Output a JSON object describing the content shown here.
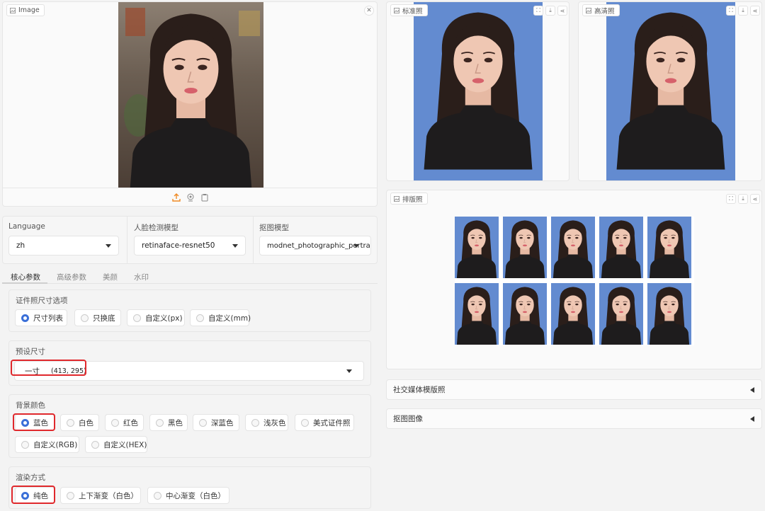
{
  "input_panel": {
    "label": "Image",
    "close_icon": "close-icon",
    "toolbar_icons": [
      "upload-icon",
      "webcam-icon",
      "clipboard-icon"
    ],
    "accent": "#f08a24"
  },
  "output_std": {
    "label": "标准照"
  },
  "output_hd": {
    "label": "高清照"
  },
  "output_layout": {
    "label": "排版照",
    "rows": 2,
    "cols": 5
  },
  "selects": {
    "language": {
      "label": "Language",
      "value": "zh"
    },
    "face_model": {
      "label": "人脸检测模型",
      "value": "retinaface-resnet50"
    },
    "matting_model": {
      "label": "抠图模型",
      "value": "modnet_photographic_portrait"
    }
  },
  "tabs": [
    "核心参数",
    "高级参数",
    "美颜",
    "水印"
  ],
  "size_option": {
    "label": "证件照尺寸选项",
    "options": [
      "尺寸列表",
      "只换底",
      "自定义(px)",
      "自定义(mm)"
    ],
    "selected": 0
  },
  "preset_size": {
    "label": "预设尺寸",
    "value_name": "一寸",
    "value_dims": "(413, 295)"
  },
  "bg_color": {
    "label": "背景颜色",
    "options": [
      "蓝色",
      "白色",
      "红色",
      "黑色",
      "深蓝色",
      "浅灰色",
      "美式证件照",
      "自定义(RGB)",
      "自定义(HEX)"
    ],
    "selected": 0,
    "blue": "#638bd0"
  },
  "render_mode": {
    "label": "渲染方式",
    "options": [
      "纯色",
      "上下渐变（白色）",
      "中心渐变（白色）"
    ],
    "selected": 0
  },
  "accordions": {
    "social": "社交媒体模版照",
    "matting": "抠图图像"
  },
  "colors": {
    "radio_accent": "#3a6fd8",
    "highlight": "#e0282c"
  }
}
